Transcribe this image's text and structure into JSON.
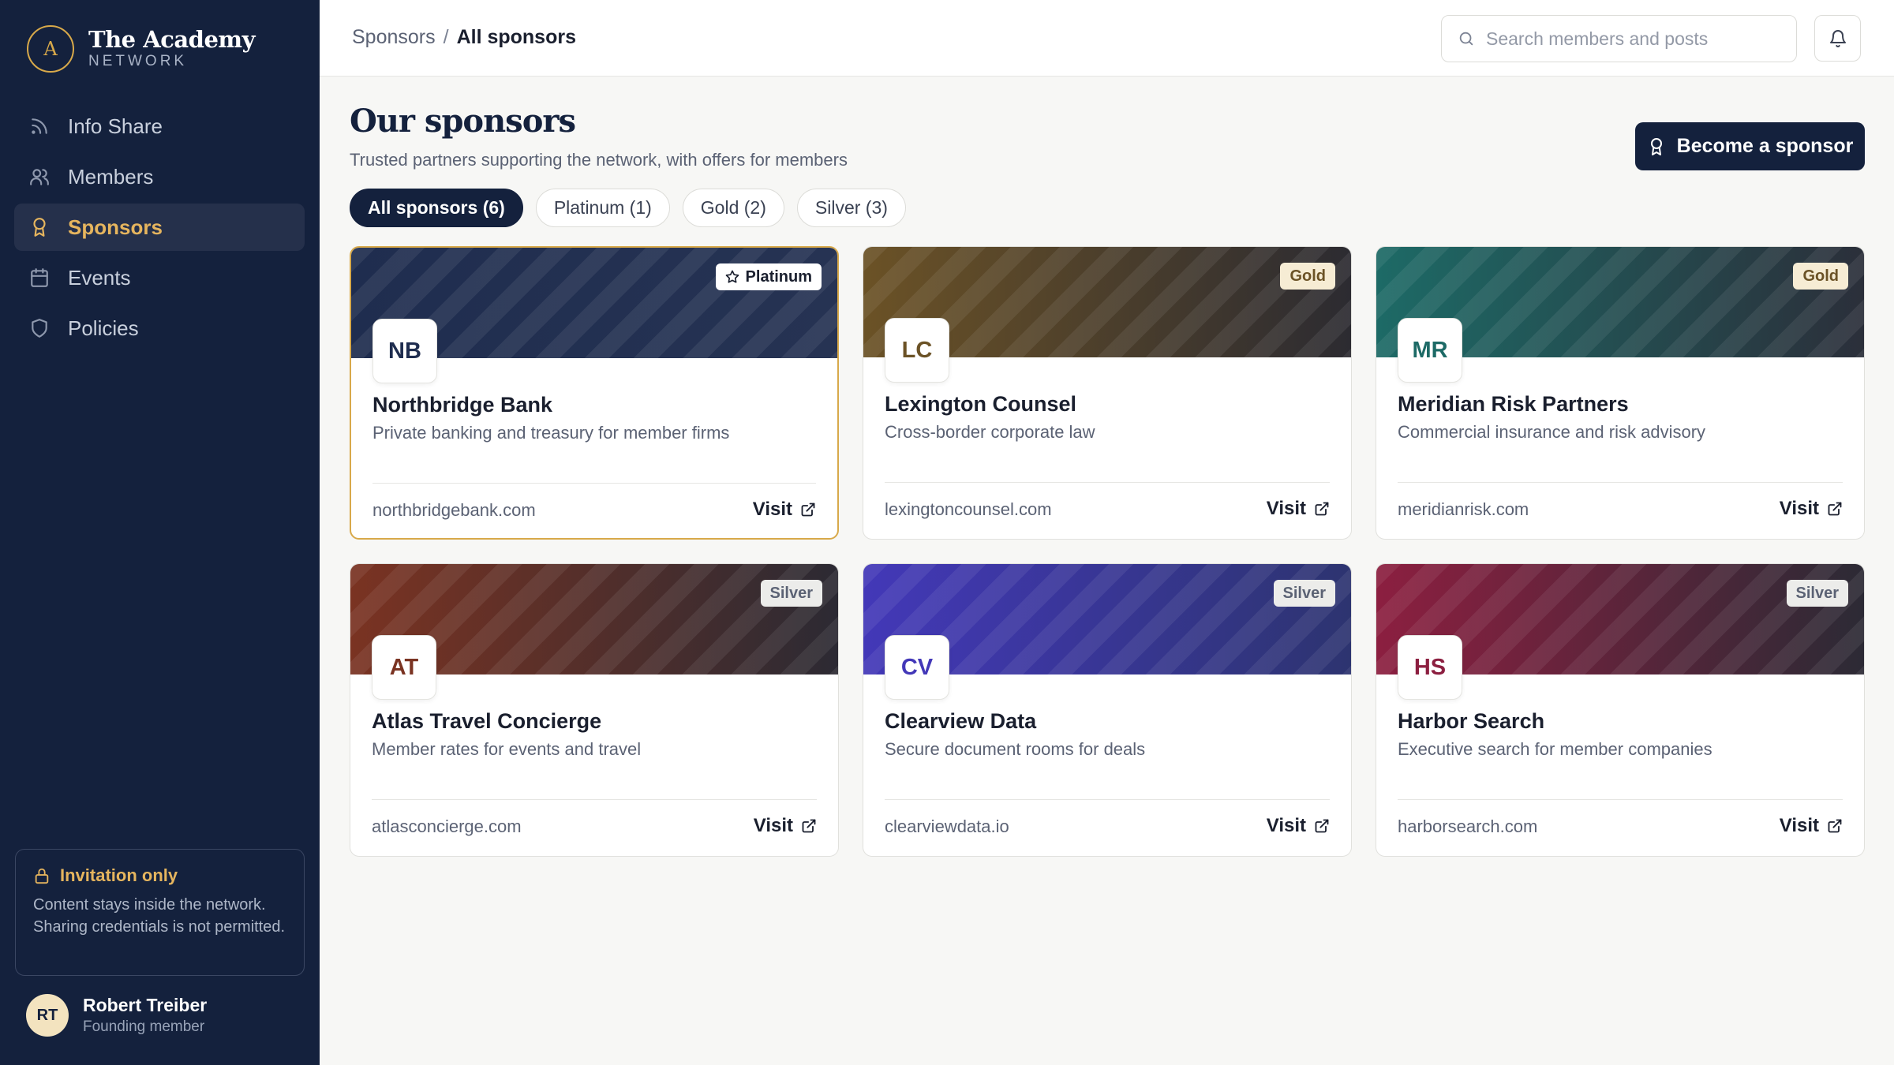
{
  "brand": {
    "mark": "A",
    "name": "The Academy",
    "sub": "NETWORK"
  },
  "nav": [
    {
      "label": "Info Share",
      "icon": "rss-icon"
    },
    {
      "label": "Members",
      "icon": "users-icon"
    },
    {
      "label": "Sponsors",
      "icon": "award-icon",
      "active": true
    },
    {
      "label": "Events",
      "icon": "calendar-icon"
    },
    {
      "label": "Policies",
      "icon": "shield-icon"
    }
  ],
  "notice": {
    "title": "Invitation only",
    "body": "Content stays inside the network. Sharing credentials is not permitted."
  },
  "user": {
    "initials": "RT",
    "name": "Robert Treiber",
    "role": "Founding member"
  },
  "topbar": {
    "breadcrumb_parent": "Sponsors",
    "breadcrumb_sep": "/",
    "breadcrumb_current": "All sponsors",
    "search_placeholder": "Search members and posts"
  },
  "header": {
    "title": "Our sponsors",
    "subtitle": "Trusted partners supporting the network, with offers for members",
    "cta": "Become a sponsor"
  },
  "filters": [
    {
      "label": "All sponsors (6)",
      "active": true
    },
    {
      "label": "Platinum (1)"
    },
    {
      "label": "Gold (2)"
    },
    {
      "label": "Silver (3)"
    }
  ],
  "visit_label": "Visit",
  "sponsors": [
    {
      "initials": "NB",
      "name": "Northbridge Bank",
      "desc": "Private banking and treasury for member firms",
      "domain": "northbridgebank.com",
      "tier": "Platinum"
    },
    {
      "initials": "LC",
      "name": "Lexington Counsel",
      "desc": "Cross-border corporate law",
      "domain": "lexingtoncounsel.com",
      "tier": "Gold"
    },
    {
      "initials": "MR",
      "name": "Meridian Risk Partners",
      "desc": "Commercial insurance and risk advisory",
      "domain": "meridianrisk.com",
      "tier": "Gold"
    },
    {
      "initials": "AT",
      "name": "Atlas Travel Concierge",
      "desc": "Member rates for events and travel",
      "domain": "atlasconcierge.com",
      "tier": "Silver"
    },
    {
      "initials": "CV",
      "name": "Clearview Data",
      "desc": "Secure document rooms for deals",
      "domain": "clearviewdata.io",
      "tier": "Silver"
    },
    {
      "initials": "HS",
      "name": "Harbor Search",
      "desc": "Executive search for member companies",
      "domain": "harborsearch.com",
      "tier": "Silver"
    }
  ],
  "colors": {
    "sidebar_bg": "#14213d",
    "accent_gold": "#d8a94a",
    "banner_northbridge": "#1f2d4f",
    "banner_lexington": "#6b5226",
    "banner_meridian": "#1d6a66",
    "banner_atlas": "#7a3322",
    "banner_clearview": "#4338b8",
    "banner_harbor": "#8c1f40"
  }
}
